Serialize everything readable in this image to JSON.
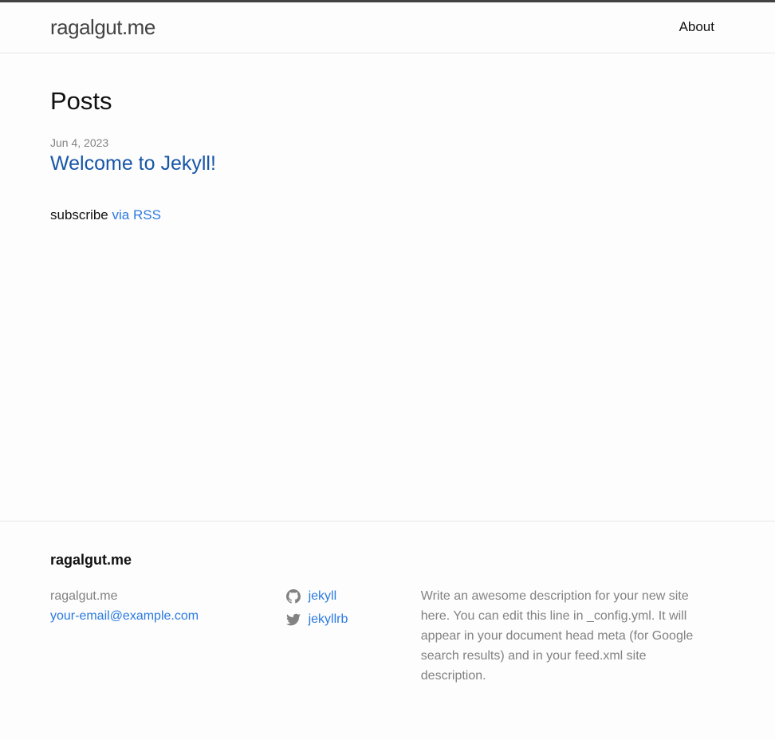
{
  "header": {
    "site_title": "ragalgut.me",
    "nav": [
      {
        "label": "About"
      }
    ]
  },
  "main": {
    "heading": "Posts",
    "posts": [
      {
        "date": "Jun 4, 2023",
        "title": "Welcome to Jekyll!"
      }
    ],
    "subscribe_text": "subscribe",
    "rss_link": "via RSS"
  },
  "footer": {
    "title": "ragalgut.me",
    "name": "ragalgut.me",
    "email": "your-email@example.com",
    "social": [
      {
        "icon": "github-icon",
        "label": "jekyll"
      },
      {
        "icon": "twitter-icon",
        "label": "jekyllrb"
      }
    ],
    "description": "Write an awesome description for your new site here. You can edit this line in _config.yml. It will appear in your document head meta (for Google search results) and in your feed.xml site description."
  },
  "colors": {
    "link": "#2a7ae2",
    "visited_link": "#1756a9",
    "text": "#111111",
    "grey": "#828282",
    "top_border": "#424242"
  }
}
